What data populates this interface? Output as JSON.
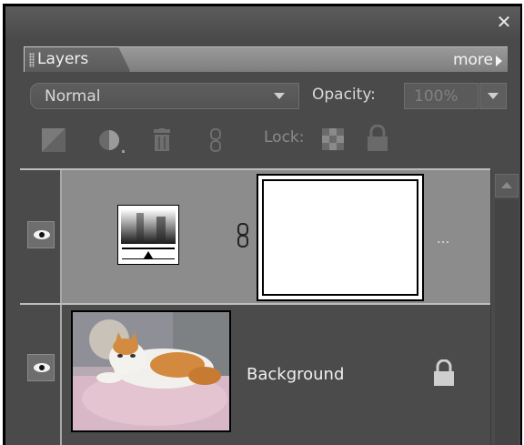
{
  "panel": {
    "close_glyph": "✕",
    "tab_label": "Layers",
    "more_label": "more"
  },
  "controls": {
    "blend_mode": "Normal",
    "opacity_label": "Opacity:",
    "opacity_value": "100%",
    "lock_label": "Lock:"
  },
  "icons": {
    "new_layer": "new-layer-icon",
    "adjustment": "adjustment-layer-icon",
    "delete": "trash-icon",
    "link": "link-icon",
    "lock_transparent": "lock-transparent-pixels-icon",
    "lock_all": "lock-icon",
    "visibility": "eye-icon"
  },
  "layers": [
    {
      "name": "",
      "thumb_icon": "levels-adjustment-icon",
      "link_icon": "chain-link-icon",
      "mask_icon": "layer-mask-thumbnail",
      "ellipsis": "...",
      "selected": true
    },
    {
      "name": "Background",
      "thumb_icon": "cat-photo-thumbnail",
      "lock_icon": "lock-icon",
      "selected": false
    }
  ],
  "colors": {
    "panel_bg": "#4a4a4a",
    "selected_row": "#8c8c8c",
    "tab_strip": "#8a8a8a"
  }
}
